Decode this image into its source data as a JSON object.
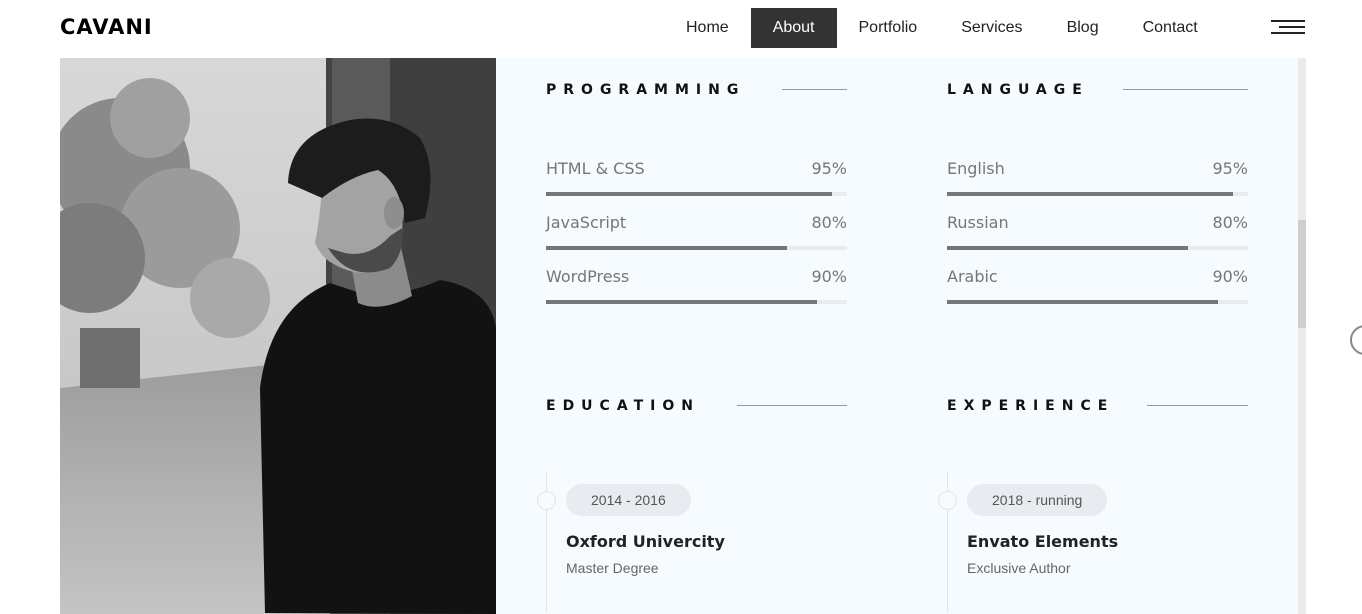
{
  "brand": {
    "logo": "CAVANI"
  },
  "nav": {
    "items": [
      {
        "label": "Home",
        "active": false
      },
      {
        "label": "About",
        "active": true
      },
      {
        "label": "Portfolio",
        "active": false
      },
      {
        "label": "Services",
        "active": false
      },
      {
        "label": "Blog",
        "active": false
      },
      {
        "label": "Contact",
        "active": false
      }
    ],
    "menu_icon": "hamburger-icon"
  },
  "programming": {
    "title": "PROGRAMMING",
    "skills": [
      {
        "name": "HTML & CSS",
        "percent": "95%",
        "level": 0.95
      },
      {
        "name": "JavaScript",
        "percent": "80%",
        "level": 0.8
      },
      {
        "name": "WordPress",
        "percent": "90%",
        "level": 0.9
      }
    ]
  },
  "language": {
    "title": "LANGUAGE",
    "skills": [
      {
        "name": "English",
        "percent": "95%",
        "level": 0.95
      },
      {
        "name": "Russian",
        "percent": "80%",
        "level": 0.8
      },
      {
        "name": "Arabic",
        "percent": "90%",
        "level": 0.9
      }
    ]
  },
  "education": {
    "title": "EDUCATION",
    "items": [
      {
        "date": "2014 - 2016",
        "title": "Oxford Univercity",
        "subtitle": "Master Degree"
      }
    ]
  },
  "experience": {
    "title": "EXPERIENCE",
    "items": [
      {
        "date": "2018 - running",
        "title": "Envato Elements",
        "subtitle": "Exclusive Author"
      }
    ]
  },
  "colors": {
    "accent_dark": "#333333",
    "content_bg": "#f6fbff",
    "bar_fill": "#767676"
  }
}
